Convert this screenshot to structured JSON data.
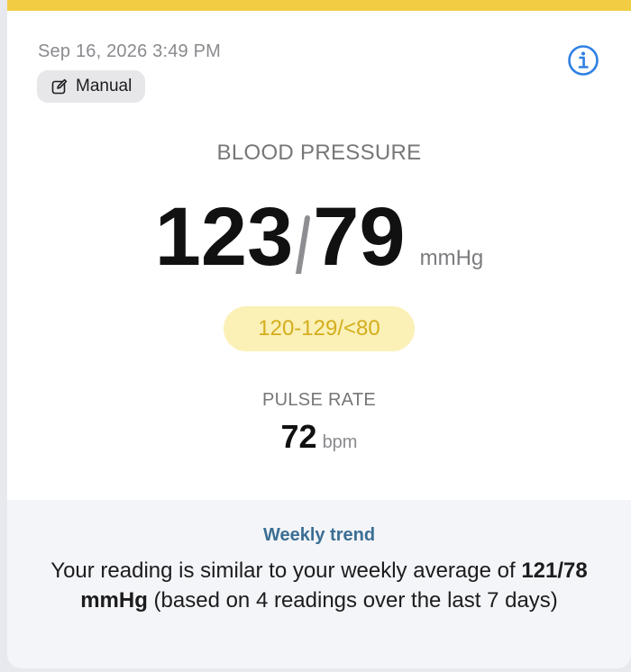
{
  "card": {
    "accent_color": "#f2cd44"
  },
  "header": {
    "timestamp": "Sep 16, 2026 3:49 PM",
    "source_chip": {
      "label": "Manual",
      "icon": "edit-icon"
    },
    "info_icon": "info-icon"
  },
  "blood_pressure": {
    "title": "BLOOD PRESSURE",
    "systolic": "123",
    "diastolic": "79",
    "unit": "mmHg",
    "category_label": "120-129/<80",
    "category_color": "#d3ae1d"
  },
  "pulse": {
    "title": "PULSE RATE",
    "value": "72",
    "unit": "bpm"
  },
  "weekly_trend": {
    "title": "Weekly trend",
    "text_before": "Your reading is similar to your weekly average of ",
    "average": "121/78 mmHg",
    "text_after": " (based on 4 readings over the last 7 days)"
  }
}
